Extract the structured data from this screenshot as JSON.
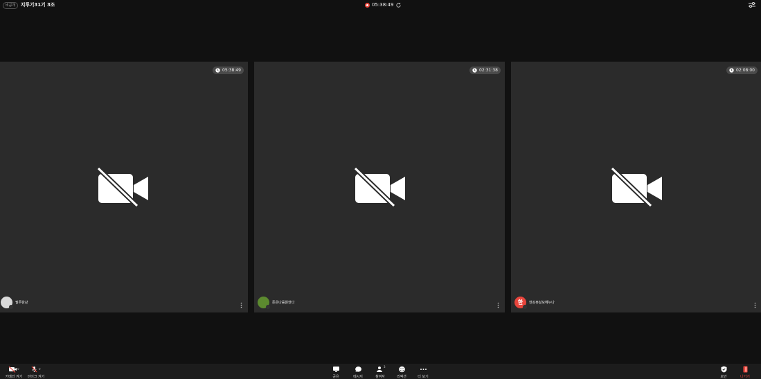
{
  "header": {
    "visibility_badge": "비공개",
    "meeting_title": "지투기31기 3조",
    "recording_time": "05:38:49"
  },
  "tiles": [
    {
      "elapsed": "05:38:49",
      "name": "필루완강",
      "avatar_letter": "",
      "avatar_color": "#d9d9d9"
    },
    {
      "elapsed": "02:31:38",
      "name": "돈은나를원한다",
      "avatar_letter": "",
      "avatar_color": "#5c8a2f"
    },
    {
      "elapsed": "02:08:00",
      "name": "한강뷰살모헤누나",
      "avatar_letter": "한",
      "avatar_color": "#e8453c"
    }
  ],
  "toolbar": {
    "camera_label": "카메라 켜기",
    "mic_label": "마이크 켜기",
    "share_label": "공유",
    "message_label": "메시지",
    "participants_label": "참여자",
    "participants_count": "3",
    "reaction_label": "리액션",
    "more_label": "더 보기",
    "security_label": "보안",
    "leave_label": "나가기"
  },
  "colors": {
    "background": "#111111",
    "tile": "#2b2b2b",
    "accent_red": "#e8453c"
  }
}
